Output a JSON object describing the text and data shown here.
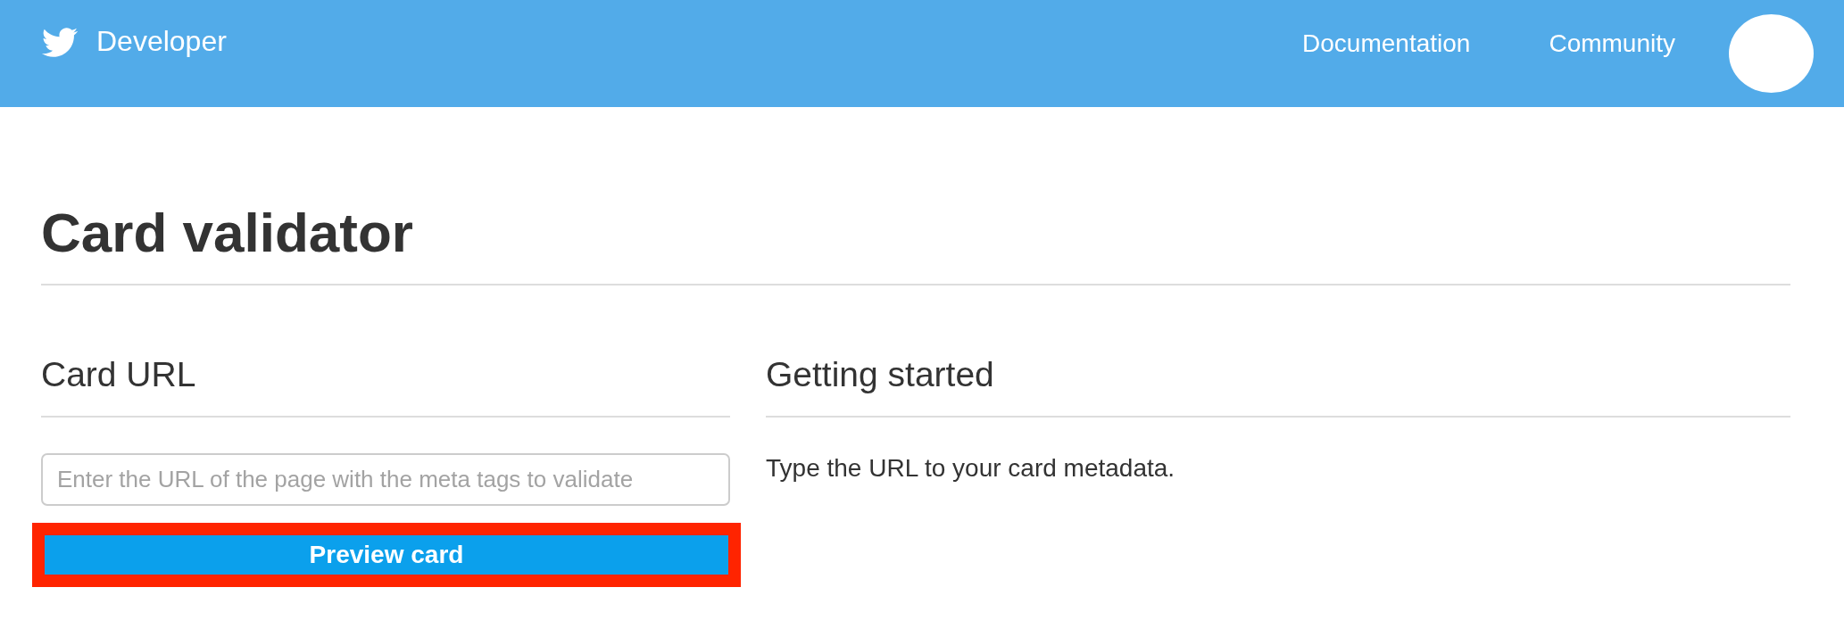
{
  "header": {
    "logo_text": "Developer",
    "nav": [
      {
        "label": "Documentation"
      },
      {
        "label": "Community"
      }
    ]
  },
  "page": {
    "title": "Card validator"
  },
  "card_url": {
    "heading": "Card URL",
    "url_field": {
      "placeholder": "Enter the URL of the page with the meta tags to validate"
    },
    "preview_button": {
      "label": "Preview card",
      "highlighted": true
    }
  },
  "getting_started": {
    "heading": "Getting started",
    "text": "Type the URL to your card metadata."
  }
}
